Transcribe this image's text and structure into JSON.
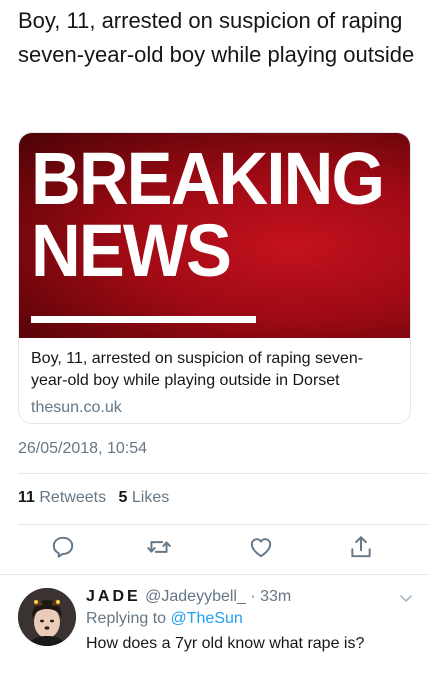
{
  "tweet": {
    "text": "Boy, 11, arrested on suspicion of raping seven-year-old boy while playing outside",
    "card": {
      "image_line1": "BREAKING",
      "image_line2": "NEWS",
      "title": "Boy, 11, arrested on suspicion of raping seven-year-old boy while playing outside in Dorset",
      "domain": "thesun.co.uk"
    },
    "timestamp": "26/05/2018, 10:54",
    "stats": {
      "retweets_count": "11",
      "retweets_label": "Retweets",
      "likes_count": "5",
      "likes_label": "Likes"
    },
    "actions": [
      "reply-icon",
      "retweet-icon",
      "like-icon",
      "share-icon"
    ]
  },
  "reply": {
    "name": "JADE",
    "handle": "@Jadeyybell_",
    "dot": "·",
    "time": "33m",
    "replying_label": "Replying to",
    "replying_to": "@TheSun",
    "text": "How does a 7yr old know what rape is?"
  },
  "colors": {
    "text": "#14171a",
    "secondary": "#657786",
    "link": "#1da1f2",
    "divider": "#e1e8ed",
    "breaking_red": "#c4121f"
  }
}
